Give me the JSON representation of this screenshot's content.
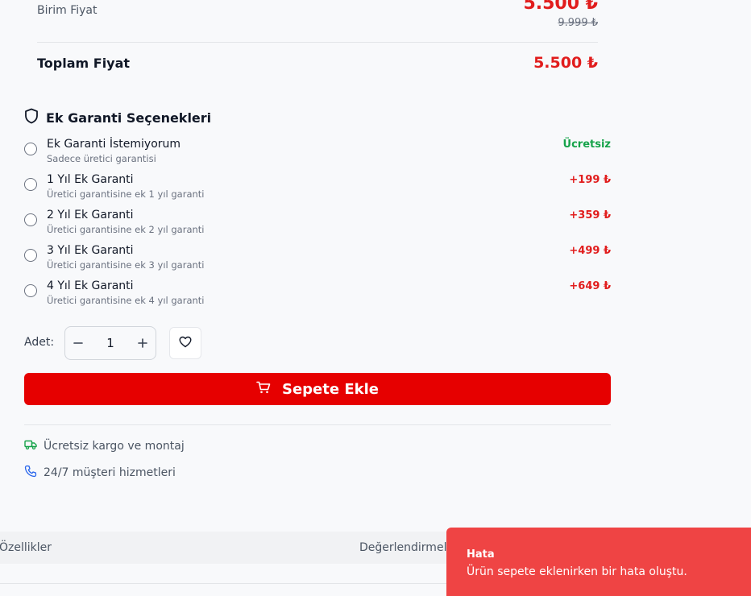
{
  "pricing": {
    "unit_label": "Birim Fiyat",
    "unit_price": "5.500 ₺",
    "old_price": "9.999 ₺",
    "total_label": "Toplam Fiyat",
    "total_price": "5.500 ₺",
    "accent_color": "#e11d1d"
  },
  "warranty": {
    "title": "Ek Garanti Seçenekleri",
    "options": [
      {
        "name": "Ek Garanti İstemiyorum",
        "desc": "Sadece üretici garantisi",
        "price": "Ücretsiz"
      },
      {
        "name": "1 Yıl Ek Garanti",
        "desc": "Üretici garantisine ek 1 yıl garanti",
        "price": "+199 ₺"
      },
      {
        "name": "2 Yıl Ek Garanti",
        "desc": "Üretici garantisine ek 2 yıl garanti",
        "price": "+359 ₺"
      },
      {
        "name": "3 Yıl Ek Garanti",
        "desc": "Üretici garantisine ek 3 yıl garanti",
        "price": "+499 ₺"
      },
      {
        "name": "4 Yıl Ek Garanti",
        "desc": "Üretici garantisine ek 4 yıl garanti",
        "price": "+649 ₺"
      }
    ]
  },
  "quantity": {
    "label": "Adet:",
    "value": "1"
  },
  "cart": {
    "label": "Sepete Ekle",
    "color": "#e60000"
  },
  "features": [
    {
      "icon": "truck-icon",
      "text": "Ücretsiz kargo ve montaj"
    },
    {
      "icon": "phone-icon",
      "text": "24/7 müşteri hizmetleri"
    }
  ],
  "tabs": [
    "Özellikler",
    "Değerlendirmeler"
  ],
  "toast": {
    "title": "Hata",
    "message": "Ürün sepete eklenirken bir hata oluştu.",
    "color": "#ef4444"
  }
}
